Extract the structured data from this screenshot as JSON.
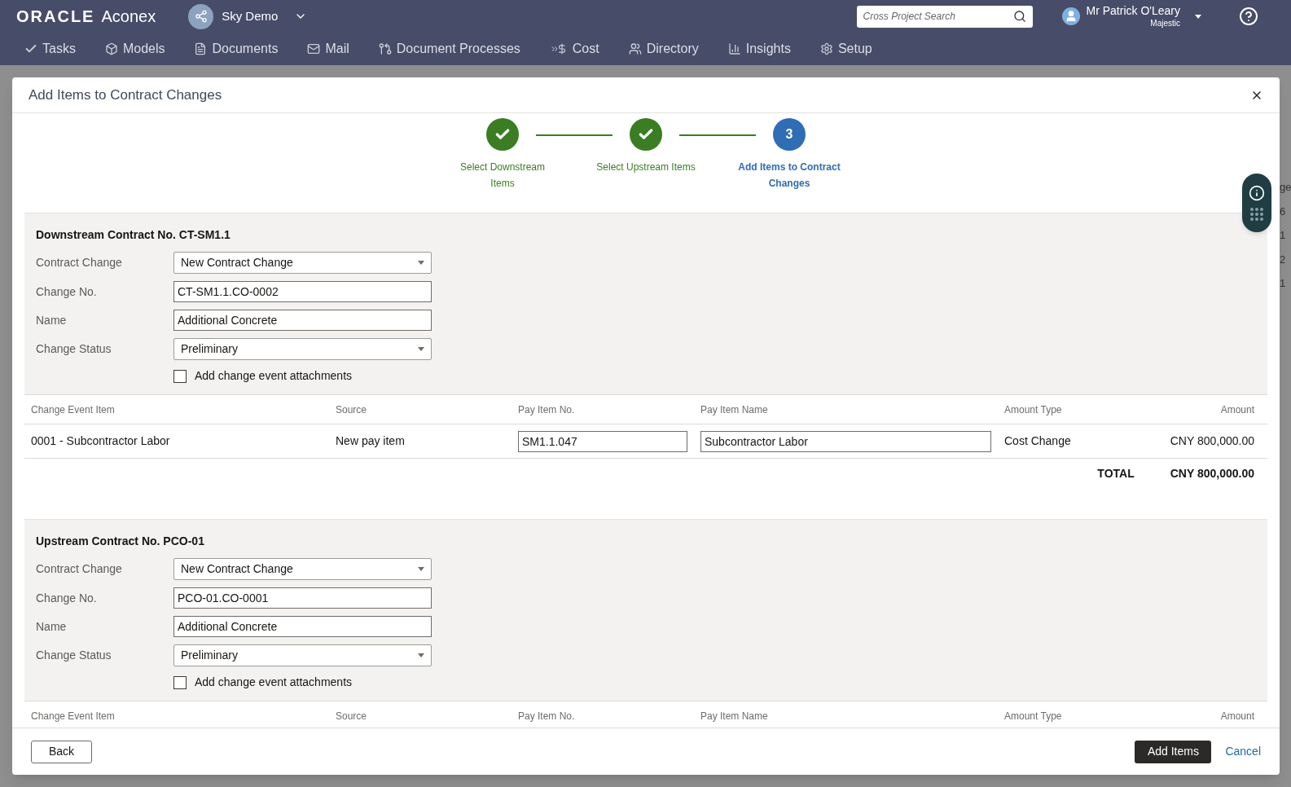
{
  "header": {
    "logo": {
      "brand": "ORACLE",
      "product": "Aconex"
    },
    "project": "Sky Demo",
    "search": {
      "placeholder": "Cross Project Search"
    },
    "user": {
      "name": "Mr Patrick O'Leary",
      "organization": "Majestic"
    },
    "nav": [
      {
        "label": "Tasks"
      },
      {
        "label": "Models"
      },
      {
        "label": "Documents"
      },
      {
        "label": "Mail"
      },
      {
        "label": "Document Processes"
      },
      {
        "label": "Cost"
      },
      {
        "label": "Directory"
      },
      {
        "label": "Insights"
      },
      {
        "label": "Setup"
      }
    ]
  },
  "background_fragments": [
    "ge",
    "6",
    "1",
    "2",
    "1"
  ],
  "modal": {
    "title": "Add Items to Contract Changes",
    "steps": [
      {
        "label": "Select Downstream Items",
        "done": true
      },
      {
        "label": "Select Upstream Items",
        "done": true
      },
      {
        "label": "Add Items to Contract Changes",
        "done": false,
        "number": "3"
      }
    ],
    "sections": [
      {
        "title": "Downstream Contract No. CT-SM1.1",
        "fields": [
          {
            "label": "Contract Change",
            "kind": "select",
            "value": "New Contract Change"
          },
          {
            "label": "Change No.",
            "kind": "text",
            "value": "CT-SM1.1.CO-0002"
          },
          {
            "label": "Name",
            "kind": "text",
            "value": "Additional Concrete"
          },
          {
            "label": "Change Status",
            "kind": "select",
            "value": "Preliminary"
          }
        ],
        "attachments": {
          "label": "Add change event attachments",
          "checked": false
        },
        "columns": [
          "Change Event Item",
          "Source",
          "Pay Item No.",
          "Pay Item Name",
          "Amount Type",
          "Amount"
        ],
        "rows": [
          {
            "item": "0001 - Subcontractor Labor",
            "source": "New pay item",
            "pay_item_no": "SM1.1.047",
            "pay_item_name": "Subcontractor Labor",
            "amount_type": "Cost Change",
            "amount": "CNY 800,000.00"
          }
        ],
        "total": {
          "label": "TOTAL",
          "amount": "CNY 800,000.00"
        }
      },
      {
        "title": "Upstream Contract No. PCO-01",
        "fields": [
          {
            "label": "Contract Change",
            "kind": "select",
            "value": "New Contract Change"
          },
          {
            "label": "Change No.",
            "kind": "text",
            "value": "PCO-01.CO-0001"
          },
          {
            "label": "Name",
            "kind": "text",
            "value": "Additional Concrete"
          },
          {
            "label": "Change Status",
            "kind": "select",
            "value": "Preliminary"
          }
        ],
        "attachments": {
          "label": "Add change event attachments",
          "checked": false
        },
        "columns": [
          "Change Event Item",
          "Source",
          "Pay Item No.",
          "Pay Item Name",
          "Amount Type",
          "Amount"
        ]
      }
    ],
    "buttons": {
      "back": "Back",
      "add": "Add Items",
      "cancel": "Cancel"
    }
  }
}
